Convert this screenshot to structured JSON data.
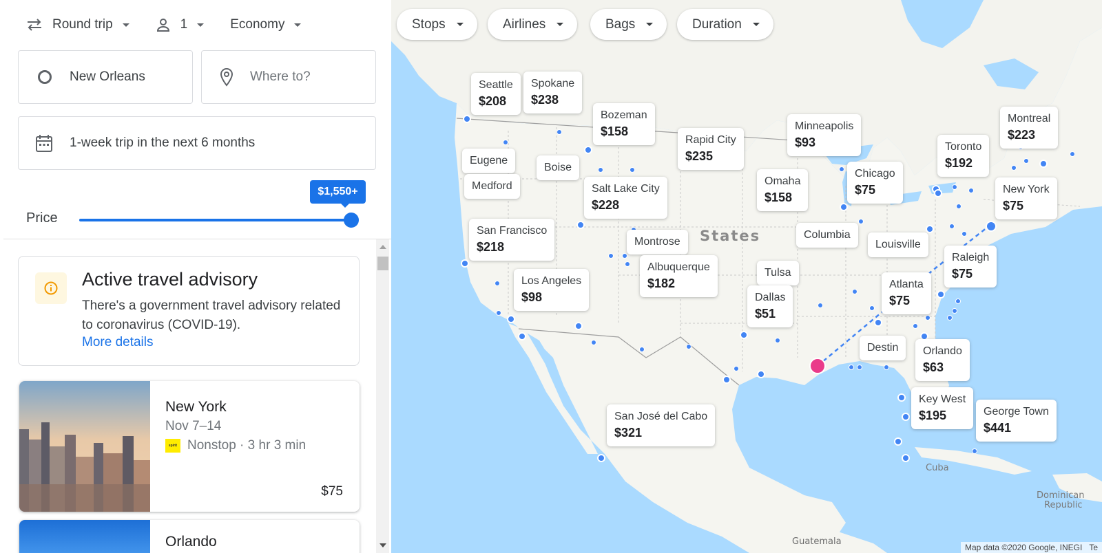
{
  "search": {
    "trip_type": "Round trip",
    "passengers": "1",
    "cabin": "Economy",
    "origin": "New Orleans",
    "destination_placeholder": "Where to?",
    "dates": "1-week trip in the next 6 months"
  },
  "price_filter": {
    "label": "Price",
    "max_label": "$1,550+",
    "level_fraction": 1.0
  },
  "advisory": {
    "title": "Active travel advisory",
    "body": "There's a government travel advisory related to coronavirus (COVID-19).",
    "link": "More details"
  },
  "results": [
    {
      "city": "New York",
      "dates": "Nov 7–14",
      "stops": "Nonstop",
      "duration": "3 hr 3 min",
      "price": "$75",
      "airline_logo": "spirit"
    },
    {
      "city": "Orlando"
    }
  ],
  "map_filters": [
    "Stops",
    "Airlines",
    "Bags",
    "Duration"
  ],
  "map_labels": {
    "seattle": {
      "name": "Seattle",
      "price": "$208"
    },
    "spokane": {
      "name": "Spokane",
      "price": "$238"
    },
    "bozeman": {
      "name": "Bozeman",
      "price": "$158"
    },
    "rapid_city": {
      "name": "Rapid City",
      "price": "$235"
    },
    "minneapolis": {
      "name": "Minneapolis",
      "price": "$93"
    },
    "montreal": {
      "name": "Montreal",
      "price": "$223"
    },
    "toronto": {
      "name": "Toronto",
      "price": "$192"
    },
    "eugene": {
      "name": "Eugene"
    },
    "boise": {
      "name": "Boise"
    },
    "medford": {
      "name": "Medford"
    },
    "salt_lake_city": {
      "name": "Salt Lake City",
      "price": "$228"
    },
    "omaha": {
      "name": "Omaha",
      "price": "$158"
    },
    "chicago": {
      "name": "Chicago",
      "price": "$75"
    },
    "new_york": {
      "name": "New York",
      "price": "$75"
    },
    "san_francisco": {
      "name": "San Francisco",
      "price": "$218"
    },
    "montrose": {
      "name": "Montrose"
    },
    "columbia": {
      "name": "Columbia"
    },
    "louisville": {
      "name": "Louisville"
    },
    "raleigh": {
      "name": "Raleigh",
      "price": "$75"
    },
    "los_angeles": {
      "name": "Los Angeles",
      "price": "$98"
    },
    "albuquerque": {
      "name": "Albuquerque",
      "price": "$182"
    },
    "tulsa": {
      "name": "Tulsa"
    },
    "dallas": {
      "name": "Dallas",
      "price": "$51"
    },
    "atlanta": {
      "name": "Atlanta",
      "price": "$75"
    },
    "destin": {
      "name": "Destin"
    },
    "orlando": {
      "name": "Orlando",
      "price": "$63"
    },
    "key_west": {
      "name": "Key West",
      "price": "$195"
    },
    "george_town": {
      "name": "George Town",
      "price": "$441"
    },
    "san_jose_del_cabo": {
      "name": "San José del Cabo",
      "price": "$321"
    }
  },
  "map_text": {
    "states": "States",
    "cuba": "Cuba",
    "dominican": "Dominican Republic",
    "guatemala": "Guatemala",
    "attribution": "Map data ©2020 Google, INEGI",
    "terms": "Te"
  },
  "colors": {
    "accent": "#1a73e8",
    "water": "#aadaff",
    "land": "#f5f5f0",
    "origin_marker": "#ea3b8a",
    "destination_dot": "#4285f4"
  }
}
